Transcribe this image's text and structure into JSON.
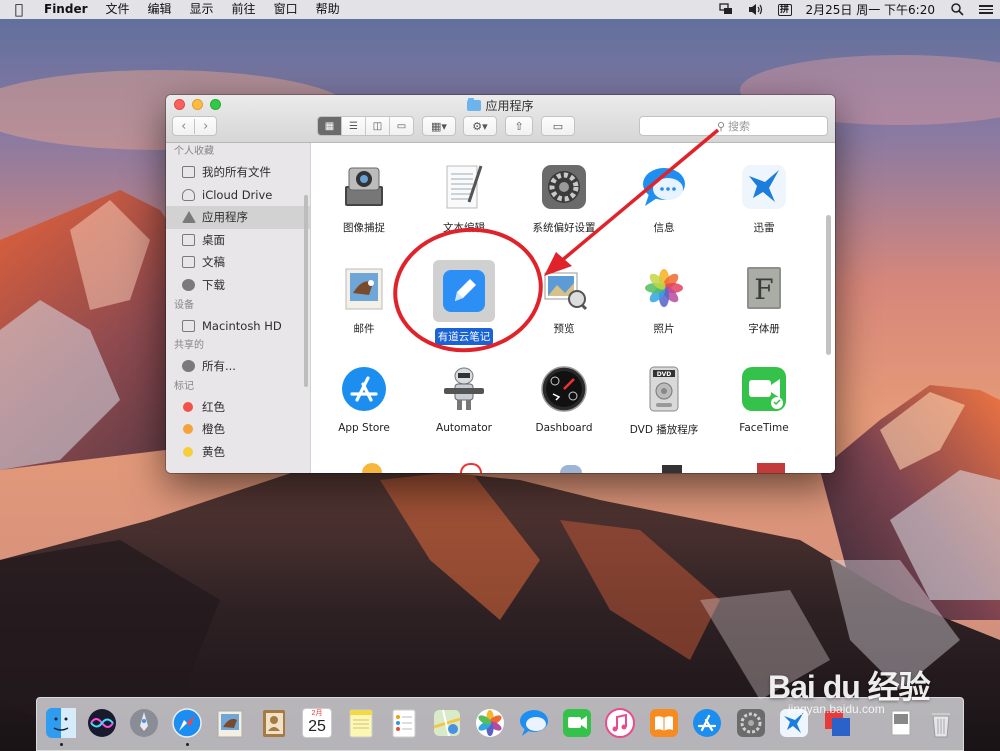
{
  "menubar": {
    "app_name": "Finder",
    "menus": [
      "文件",
      "编辑",
      "显示",
      "前往",
      "窗口",
      "帮助"
    ],
    "input_method": "拼",
    "datetime": "2月25日 周一 下午6:20"
  },
  "window": {
    "title": "应用程序",
    "search_placeholder": "搜索"
  },
  "sidebar": {
    "sections": {
      "favorites": "个人收藏",
      "devices": "设备",
      "shared": "共享的",
      "tags": "标记"
    },
    "favorites": [
      "我的所有文件",
      "iCloud Drive",
      "应用程序",
      "桌面",
      "文稿",
      "下载"
    ],
    "devices": [
      "Macintosh HD"
    ],
    "shared": [
      "所有..."
    ],
    "tags": [
      {
        "label": "红色",
        "color": "#f2524a"
      },
      {
        "label": "橙色",
        "color": "#f6a23a"
      },
      {
        "label": "黄色",
        "color": "#f5cf3a"
      }
    ]
  },
  "apps": [
    {
      "label": "图像捕捉",
      "icon": "image-capture-icon"
    },
    {
      "label": "文本编辑",
      "icon": "textedit-icon"
    },
    {
      "label": "系统偏好设置",
      "icon": "system-preferences-icon"
    },
    {
      "label": "信息",
      "icon": "messages-icon"
    },
    {
      "label": "迅雷",
      "icon": "xunlei-icon"
    },
    {
      "label": "邮件",
      "icon": "mail-icon"
    },
    {
      "label": "有道云笔记",
      "icon": "youdao-note-icon",
      "selected": true
    },
    {
      "label": "预览",
      "icon": "preview-icon"
    },
    {
      "label": "照片",
      "icon": "photos-icon"
    },
    {
      "label": "字体册",
      "icon": "font-book-icon"
    },
    {
      "label": "App Store",
      "icon": "app-store-icon"
    },
    {
      "label": "Automator",
      "icon": "automator-icon"
    },
    {
      "label": "Dashboard",
      "icon": "dashboard-icon"
    },
    {
      "label": "DVD 播放程序",
      "icon": "dvd-player-icon"
    },
    {
      "label": "FaceTime",
      "icon": "facetime-icon"
    }
  ],
  "dock": {
    "calendar_month": "2月",
    "calendar_day": "25"
  },
  "watermark": {
    "brand": "Bai du 经验",
    "url": "jingyan.baidu.com"
  },
  "colors": {
    "selection": "#1a63d6",
    "annotation": "#e0232a"
  }
}
